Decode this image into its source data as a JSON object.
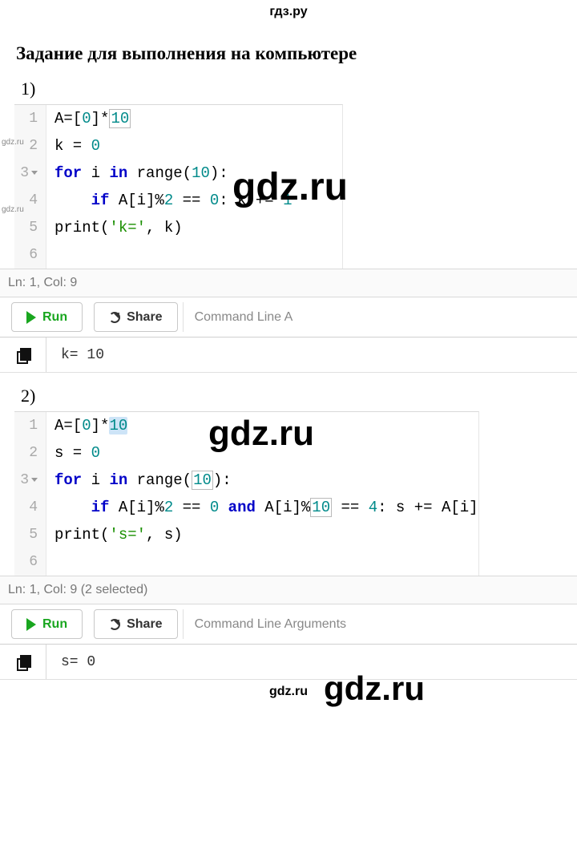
{
  "brand_top": "гдз.ру",
  "brand_bottom": "gdz.ru",
  "heading": "Задание для выполнения на компьютере",
  "watermark_side": "gdz.ru",
  "watermark_big": "gdz.ru",
  "item1_label": "1)",
  "item2_label": "2)",
  "editor1": {
    "lines": {
      "l1": "A=[0]*10",
      "l2": "k = 0",
      "l3a": "for",
      "l3b": " i ",
      "l3c": "in",
      "l3d": " range(",
      "l3e": "10",
      "l3f": "):",
      "l4a": "    ",
      "l4b": "if",
      "l4c": " A[i]%",
      "l4d": "2",
      "l4e": " == ",
      "l4f": "0",
      "l4g": ": k += ",
      "l4h": "1",
      "l5a": "print",
      "l5b": "(",
      "l5c": "'k='",
      "l5d": ", k)"
    },
    "gutters": {
      "g1": "1",
      "g2": "2",
      "g3": "3",
      "g4": "4",
      "g5": "5",
      "g6": "6"
    },
    "status": "Ln: 1, Col: 9",
    "run_label": "Run",
    "share_label": "Share",
    "cli_placeholder": "Command Line A",
    "output": "k= 10"
  },
  "editor2": {
    "lines": {
      "l1a": "A=[",
      "l1b": "0",
      "l1c": "]*",
      "l1d": "10",
      "l2": "s = 0",
      "l3a": "for",
      "l3b": " i ",
      "l3c": "in",
      "l3d": " range(",
      "l3e": "10",
      "l3f": "):",
      "l4a": "    ",
      "l4b": "if",
      "l4c": " A[i]%",
      "l4d": "2",
      "l4e": " == ",
      "l4f": "0",
      "l4g": " and ",
      "l4h": "A[i]%",
      "l4i": "10",
      "l4j": " == ",
      "l4k": "4",
      "l4l": ": s += A[i]",
      "l5a": "print",
      "l5b": "(",
      "l5c": "'s='",
      "l5d": ", s)"
    },
    "gutters": {
      "g1": "1",
      "g2": "2",
      "g3": "3",
      "g4": "4",
      "g5": "5",
      "g6": "6"
    },
    "status": "Ln: 1, Col: 9 (2 selected)",
    "run_label": "Run",
    "share_label": "Share",
    "cli_placeholder": "Command Line Arguments",
    "output": "s= 0"
  }
}
